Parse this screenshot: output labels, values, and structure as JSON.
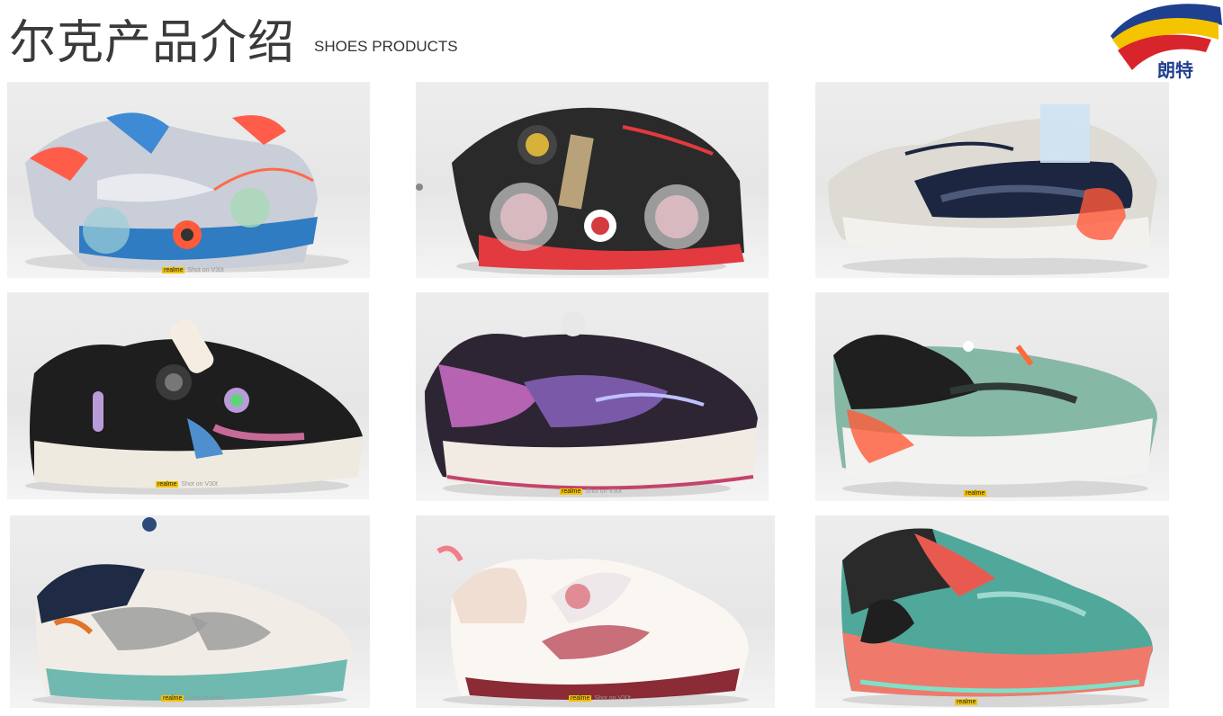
{
  "header": {
    "title_cn": "尔克产品介绍",
    "title_en": "SHOES PRODUCTS"
  },
  "logo": {
    "text": "朗特",
    "colors": {
      "blue": "#1f3f8f",
      "yellow": "#f5c400",
      "red": "#d8242b"
    }
  },
  "gallery": {
    "items": [
      {
        "name": "shoe-grey-blue-kids"
      },
      {
        "name": "shoe-black-red-light"
      },
      {
        "name": "shoe-beige-navy-running"
      },
      {
        "name": "shoe-black-cream-dial"
      },
      {
        "name": "shoe-purple-pink-dial"
      },
      {
        "name": "shoe-mint-black-running"
      },
      {
        "name": "shoe-white-grey-dial"
      },
      {
        "name": "shoe-white-pink-xtep"
      },
      {
        "name": "shoe-coral-teal-basketball"
      }
    ],
    "watermark_brand": "realme",
    "watermark_text": "Shot on V30t"
  }
}
